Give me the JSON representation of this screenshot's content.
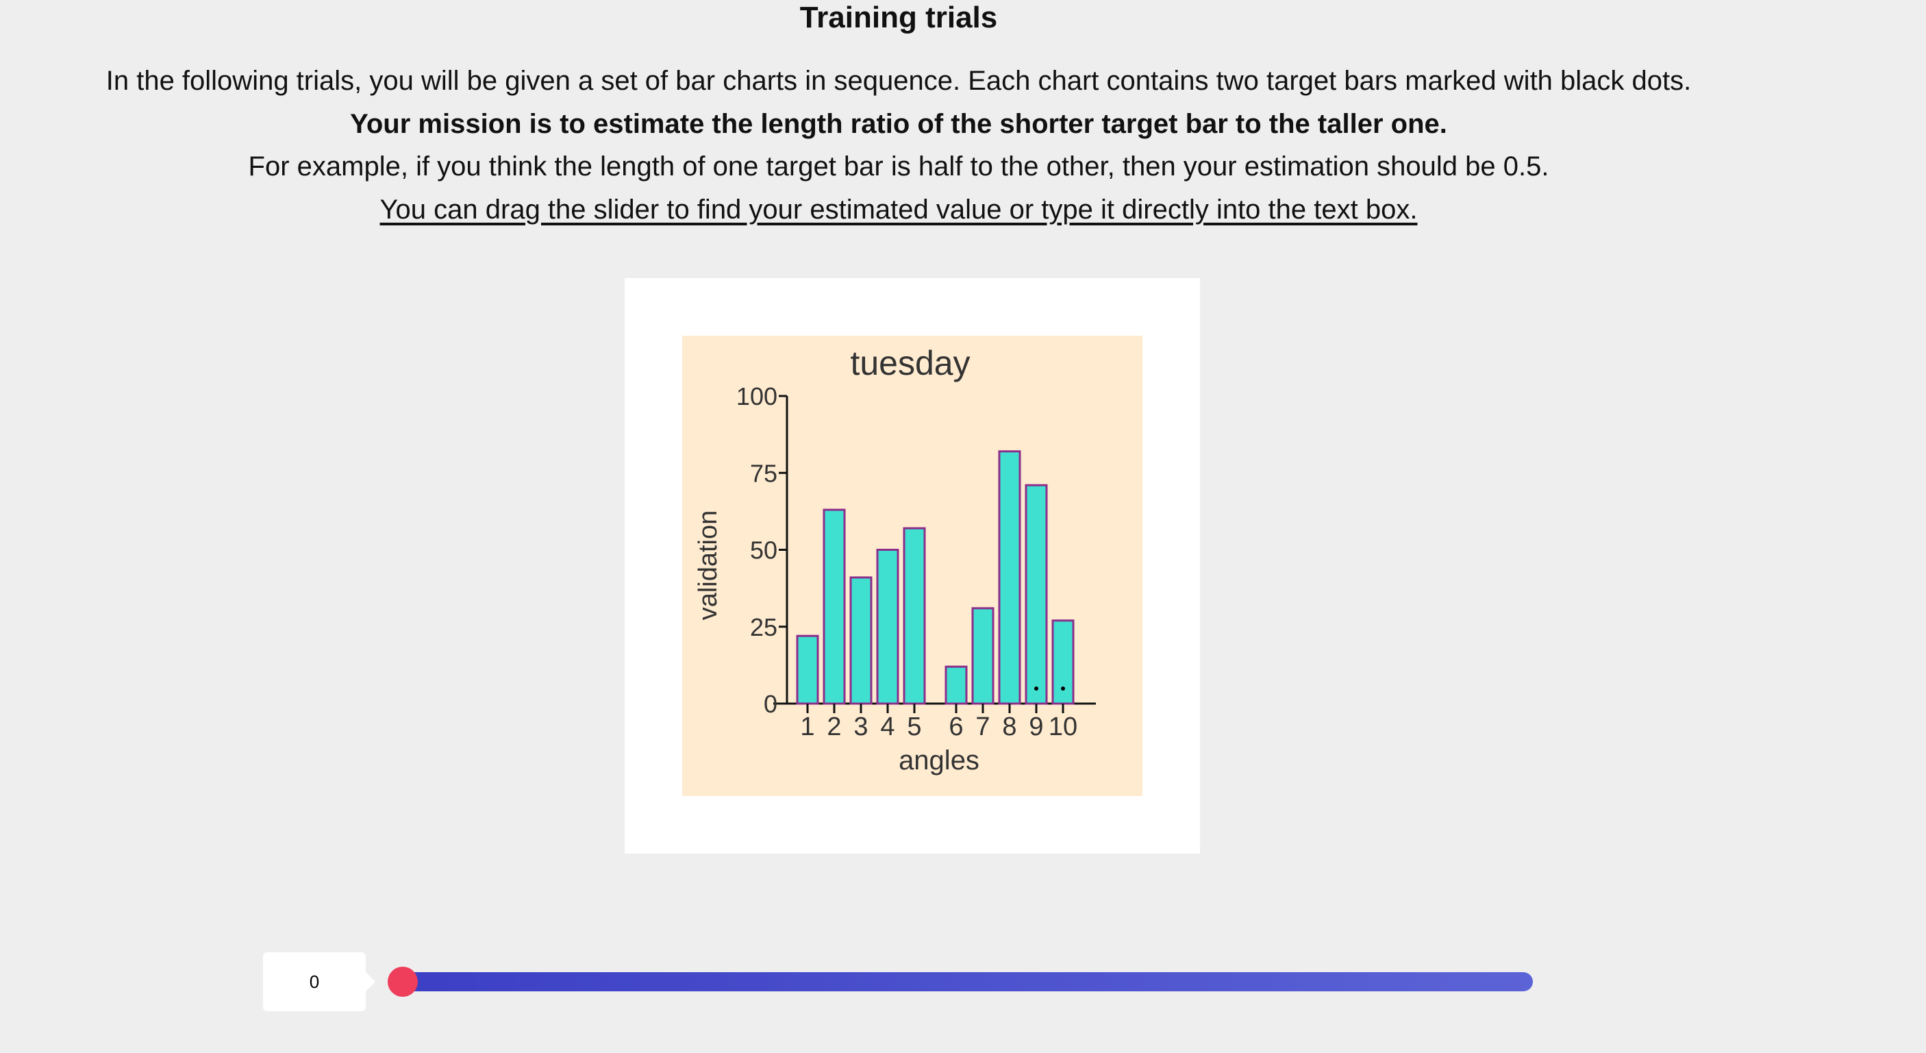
{
  "title": "Training trials",
  "instructions": {
    "line1": "In the following trials, you will be given a set of bar charts in sequence. Each chart contains two target bars marked with black dots.",
    "line2": "Your mission is to estimate the length ratio of the shorter target bar to the taller one.",
    "line3": "For example, if you think the length of one target bar is half to the other, then your estimation should be 0.5.",
    "line4": "You can drag the slider to find your estimated value or type it directly into the text box."
  },
  "slider": {
    "value": "0",
    "level": 0
  },
  "colors": {
    "background": "#eeeeee",
    "chart_background": "#ffebd0",
    "bar_fill": "#40e0d0",
    "bar_stroke": "#8b2e8b",
    "slider_track": "#3c3fc4",
    "slider_thumb": "#ef3e5c"
  },
  "chart_data": {
    "type": "bar",
    "title": "tuesday",
    "xlabel": "angles",
    "ylabel": "validation",
    "categories": [
      "1",
      "2",
      "3",
      "4",
      "5",
      "6",
      "7",
      "8",
      "9",
      "10"
    ],
    "values": [
      22,
      63,
      41,
      50,
      57,
      12,
      31,
      82,
      71,
      27
    ],
    "ylim": [
      0,
      100
    ],
    "yticks": [
      "0",
      "25",
      "50",
      "75",
      "100"
    ],
    "marked_categories": [
      "9",
      "10"
    ],
    "grid": false
  }
}
